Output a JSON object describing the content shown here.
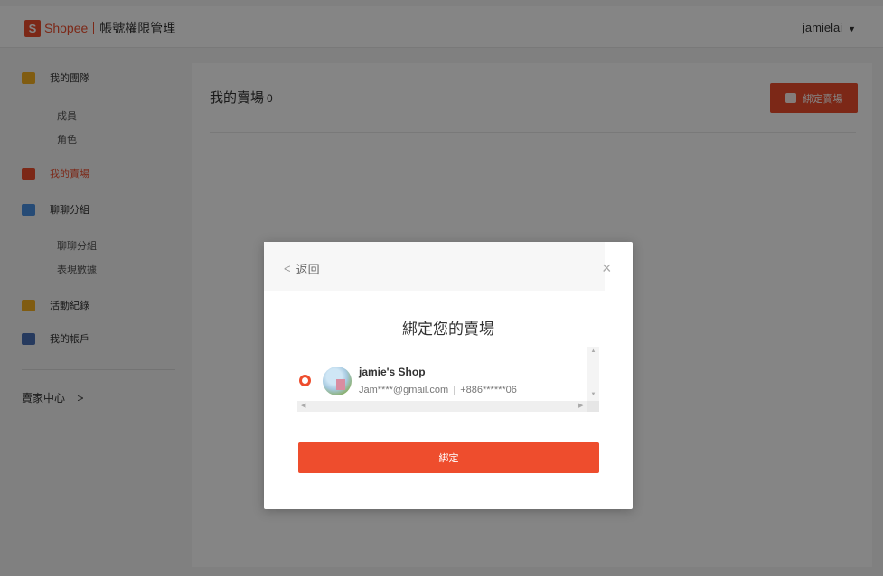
{
  "header": {
    "brand_mark": "S",
    "brand_name": "Shopee",
    "brand_subtitle": "帳號權限管理",
    "username": "jamielai",
    "caret": "▼"
  },
  "sidebar": {
    "groups": [
      {
        "label": "我的團隊",
        "icon": "team-icon",
        "active": false
      },
      {
        "label": "我的賣場",
        "icon": "store-icon",
        "active": true
      },
      {
        "label": "聊聊分組",
        "icon": "chat-icon",
        "active": false
      },
      {
        "label": "活動紀錄",
        "icon": "activity-log-icon",
        "active": false
      },
      {
        "label": "我的帳戶",
        "icon": "account-icon",
        "active": false
      }
    ],
    "team_sub": [
      "成員",
      "角色"
    ],
    "chat_sub": [
      "聊聊分組",
      "表現數據"
    ],
    "seller_center": "賣家中心",
    "seller_center_arrow": ">"
  },
  "main": {
    "title": "我的賣場",
    "count": "0",
    "bind_button": "綁定賣場"
  },
  "modal": {
    "back_label": "返回",
    "back_icon": "<",
    "close_icon": "×",
    "title": "綁定您的賣場",
    "shop": {
      "name": "jamie's Shop",
      "email": "Jam****@gmail.com",
      "phone": "+886******06",
      "selected": true
    },
    "confirm_button": "綁定"
  },
  "colors": {
    "accent": "#ee4d2d",
    "sidebar_icon_team": "#f5b021",
    "sidebar_icon_chat": "#4a90e2",
    "sidebar_icon_activity": "#f5b021",
    "sidebar_icon_account": "#4a6fb5"
  }
}
